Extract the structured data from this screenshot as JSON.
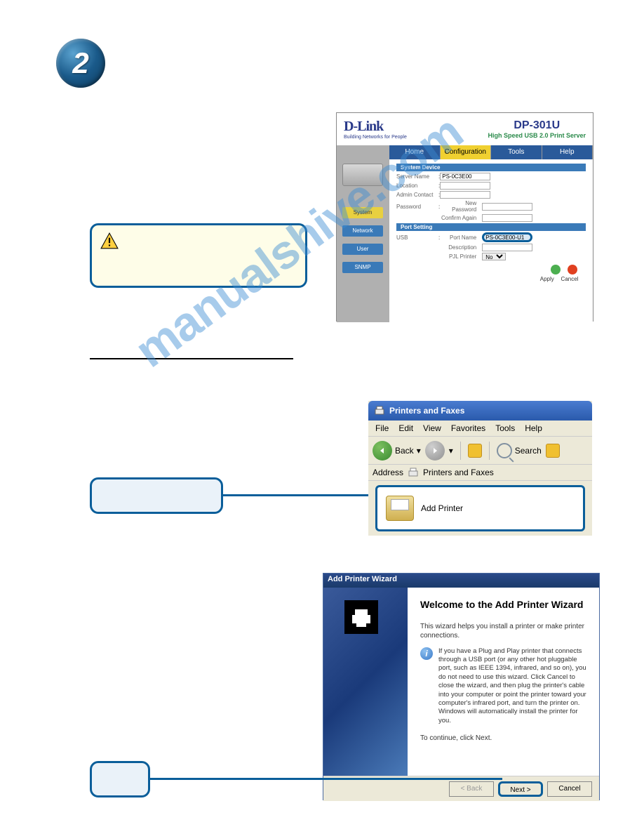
{
  "badge_number": "2",
  "watermark": "manualshive.com",
  "dlink": {
    "logo": "D-Link",
    "tagline": "Building Networks for People",
    "model": "DP-301U",
    "subtitle": "High Speed USB 2.0 Print Server",
    "tabs": {
      "home": "Home",
      "config": "Configuration",
      "tools": "Tools",
      "help": "Help"
    },
    "side": {
      "system": "System",
      "network": "Network",
      "user": "User",
      "snmp": "SNMP"
    },
    "section_system": "System Device",
    "labels": {
      "server_name": "Server Name",
      "location": "Location",
      "admin_contact": "Admin Contact",
      "password": "Password",
      "new_password": "New Password",
      "confirm_again": "Confirm Again"
    },
    "server_name_value": "PS-0C3E00",
    "section_port": "Port Setting",
    "port_row": "USB",
    "port_labels": {
      "port_name": "Port Name",
      "description": "Description",
      "pjl_printer": "PJL Printer"
    },
    "port_name_value": "PS-0C3E00-U1",
    "pjl_value": "No",
    "apply": "Apply",
    "cancel": "Cancel"
  },
  "pf": {
    "title": "Printers and Faxes",
    "menu": {
      "file": "File",
      "edit": "Edit",
      "view": "View",
      "favorites": "Favorites",
      "tools": "Tools",
      "help": "Help"
    },
    "back": "Back",
    "search": "Search",
    "address_label": "Address",
    "address_value": "Printers and Faxes",
    "add_printer": "Add Printer"
  },
  "wizard": {
    "title": "Add Printer Wizard",
    "heading": "Welcome to the Add Printer Wizard",
    "p1": "This wizard helps you install a printer or make printer connections.",
    "info": "If you have a Plug and Play printer that connects through a USB port (or any other hot pluggable port, such as IEEE 1394, infrared, and so on), you do not need to use this wizard. Click Cancel to close the wizard, and then plug the printer's cable into your computer or point the printer toward your computer's infrared port, and turn the printer on. Windows will automatically install the printer for you.",
    "p2": "To continue, click Next.",
    "back": "< Back",
    "next": "Next >",
    "cancel": "Cancel"
  }
}
